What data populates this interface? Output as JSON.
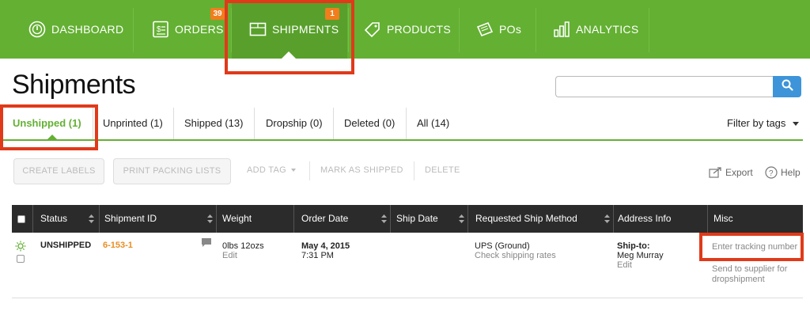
{
  "nav": {
    "items": [
      {
        "label": "DASHBOARD",
        "icon": "dashboard-gauge-icon"
      },
      {
        "label": "ORDERS",
        "icon": "orders-receipt-icon",
        "badge": "39"
      },
      {
        "label": "SHIPMENTS",
        "icon": "shipments-box-icon",
        "badge": "1",
        "active": true
      },
      {
        "label": "PRODUCTS",
        "icon": "products-tag-icon"
      },
      {
        "label": "POs",
        "icon": "pos-ticket-icon"
      },
      {
        "label": "ANALYTICS",
        "icon": "analytics-bars-icon"
      }
    ]
  },
  "page": {
    "title": "Shipments"
  },
  "search": {
    "placeholder": "",
    "icon": "search-icon"
  },
  "tabs": [
    {
      "label": "Unshipped (1)",
      "active": true
    },
    {
      "label": "Unprinted (1)"
    },
    {
      "label": "Shipped (13)"
    },
    {
      "label": "Dropship (0)"
    },
    {
      "label": "Deleted (0)"
    },
    {
      "label": "All (14)"
    }
  ],
  "filter": {
    "label": "Filter by tags"
  },
  "toolbar": {
    "create_labels": "CREATE LABELS",
    "print_packing": "PRINT PACKING LISTS",
    "add_tag": "ADD TAG",
    "mark_shipped": "MARK AS SHIPPED",
    "delete": "DELETE",
    "export": "Export",
    "help": "Help"
  },
  "table": {
    "headers": [
      "Status",
      "Shipment ID",
      "Weight",
      "Order Date",
      "Ship Date",
      "Requested Ship Method",
      "Address Info",
      "Misc"
    ],
    "rows": [
      {
        "status": "UNSHIPPED",
        "shipment_id": "6-153-1",
        "weight_main": "0lbs 12ozs",
        "weight_edit": "Edit",
        "order_date": "May 4, 2015",
        "order_time": "7:31 PM",
        "ship_date": "",
        "method": "UPS (Ground)",
        "method_link": "Check shipping rates",
        "address_label": "Ship-to:",
        "address_name": "Meg Murray",
        "address_edit": "Edit",
        "tracking_placeholder": "Enter tracking number",
        "misc_link_1": "Send to supplier for",
        "misc_link_2": "dropshipment"
      }
    ]
  },
  "colors": {
    "brand_green": "#64b033",
    "badge_orange": "#f27d1c",
    "highlight_red": "#e03a1a",
    "search_blue": "#3d94d9",
    "id_orange": "#e98e24"
  }
}
